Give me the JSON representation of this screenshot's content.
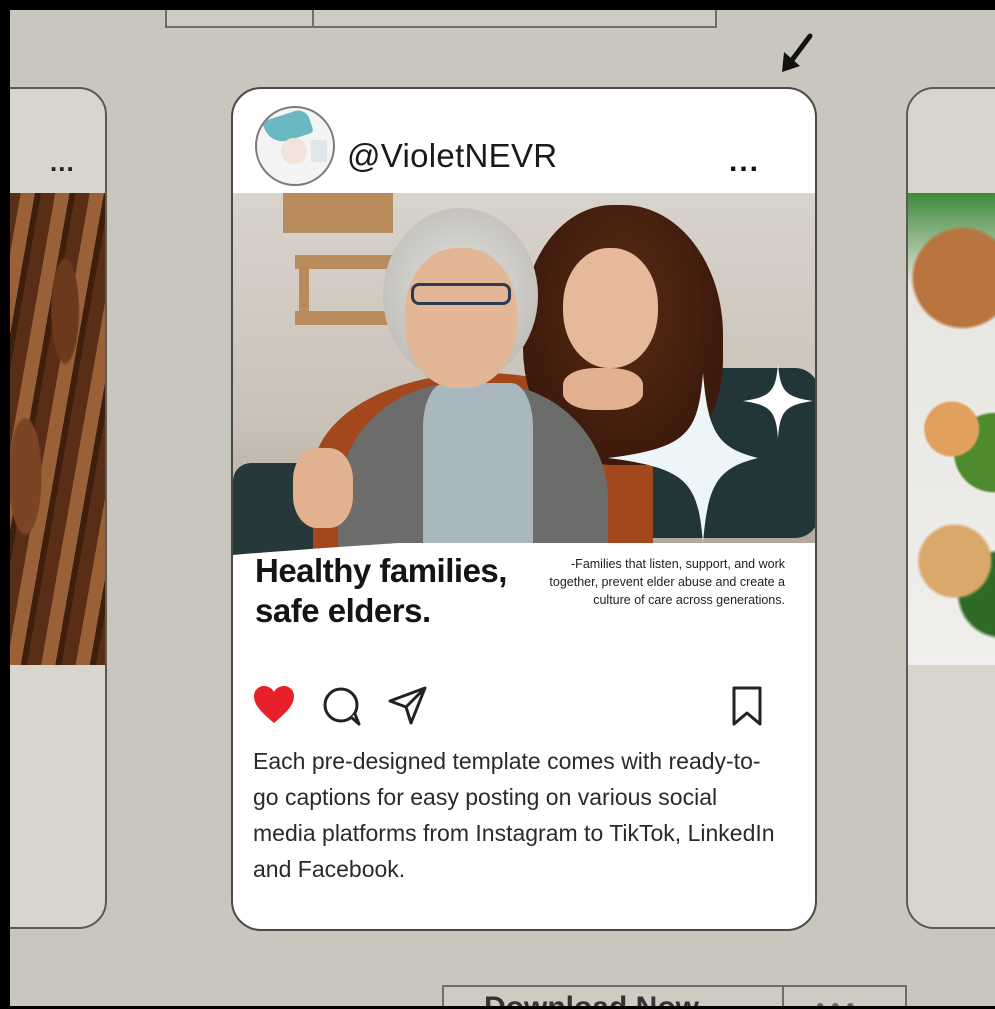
{
  "post": {
    "handle": "@VioletNEVR",
    "more_label": "...",
    "headline_line1": "Healthy families,",
    "headline_line2": "safe elders.",
    "quote": "-Families that listen, support, and work together, prevent elder abuse and create a culture of care across generations.",
    "caption": "Each pre-designed template comes with ready-to-go captions for easy posting on various social media platforms from Instagram to TikTok, LinkedIn and Facebook.",
    "liked": true,
    "like_color": "#e8202a"
  },
  "side_cards": {
    "left_more_label": "..."
  },
  "bottom_bar": {
    "primary_label": "Download Now",
    "secondary_label": "• • •"
  },
  "icons": [
    "heart-icon",
    "comment-icon",
    "share-icon",
    "bookmark-icon",
    "arrow-down-left-icon",
    "sparkle-icon",
    "more-icon"
  ]
}
